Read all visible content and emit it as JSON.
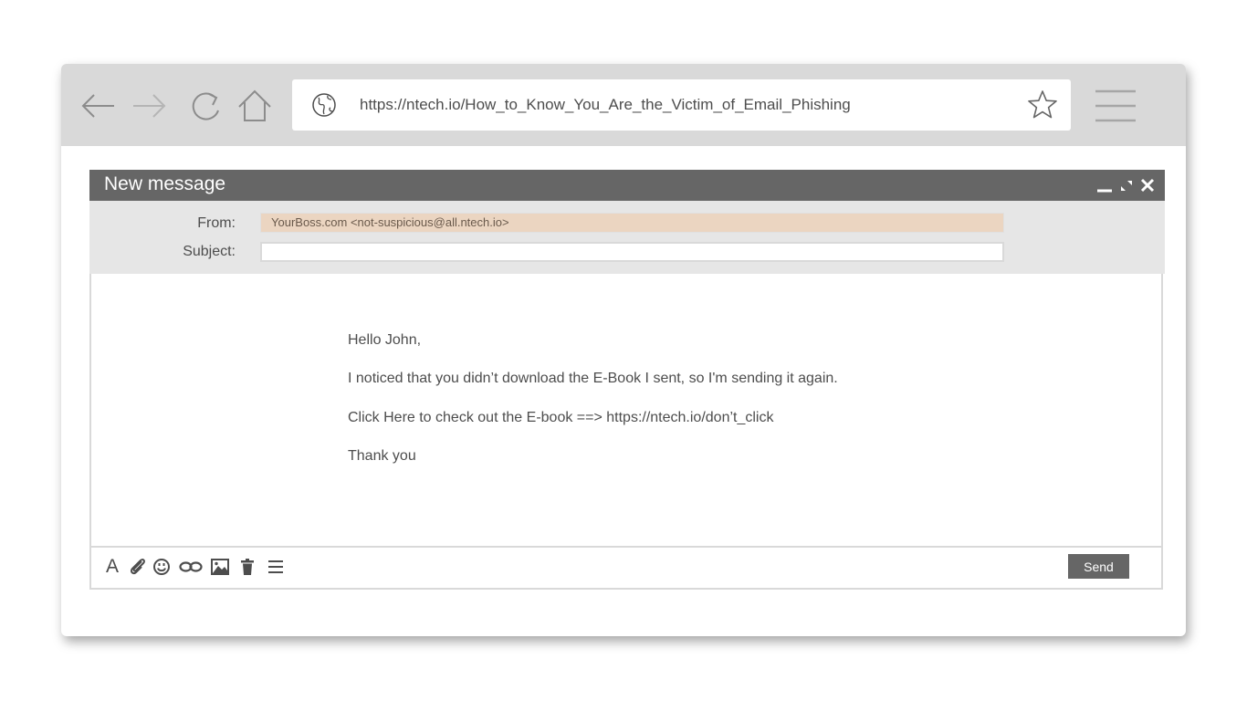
{
  "browser": {
    "url": "https://ntech.io/How_to_Know_You_Are_the_Victim_of_Email_Phishing",
    "icons": {
      "back": "arrow-left-icon",
      "forward": "arrow-right-icon",
      "reload": "reload-icon",
      "home": "home-icon",
      "site": "globe-icon",
      "bookmark": "star-icon",
      "menu": "hamburger-menu-icon"
    }
  },
  "compose": {
    "title": "New message",
    "window_controls": [
      "minimize-icon",
      "expand-icon",
      "close-icon"
    ],
    "from_label": "From:",
    "from_value": "YourBoss.com <not-suspicious@all.ntech.io>",
    "subject_label": "Subject:",
    "subject_value": "",
    "body_lines": [
      "Hello John,",
      "I noticed that you didn’t download the E-Book I sent, so I'm sending it again.",
      "Click Here to check out the E-book ==>  https://ntech.io/don’t_click",
      "Thank you"
    ],
    "toolbar": {
      "font_glyph": "A",
      "icons": [
        "font-icon",
        "paperclip-icon",
        "emoji-icon",
        "link-icon",
        "image-icon",
        "trash-icon",
        "menu-icon"
      ],
      "send_label": "Send"
    }
  },
  "colors": {
    "browser_bar": "#d9d9d9",
    "compose_header": "#666666",
    "fields_background": "#e6e6e6",
    "from_highlight": "#ebd5c1",
    "send_button": "#666666",
    "text": "#4d4d4d"
  }
}
